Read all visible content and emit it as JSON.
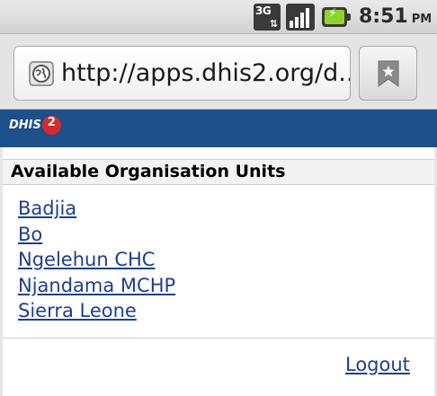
{
  "status_bar": {
    "network_label": "3G",
    "network_arrows": "⇅",
    "time": "8:51",
    "ampm": "PM",
    "icons": [
      "network-3g-icon",
      "signal-icon",
      "battery-charging-icon"
    ]
  },
  "browser": {
    "url": "http://apps.dhis2.org/d...",
    "icons": [
      "globe-icon",
      "bookmark-icon"
    ]
  },
  "header": {
    "logo_text": "DHIS",
    "logo_number": "2"
  },
  "main": {
    "section_title": "Available Organisation Units",
    "org_units": [
      "Badjia",
      "Bo",
      "Ngelehun CHC",
      "Njandama MCHP",
      "Sierra Leone"
    ],
    "logout_label": "Logout"
  },
  "colors": {
    "header_bg": "#1d4f8a",
    "link": "#1d3f8f",
    "logo_accent": "#d62a2a",
    "battery_fill": "#8fd42b"
  }
}
